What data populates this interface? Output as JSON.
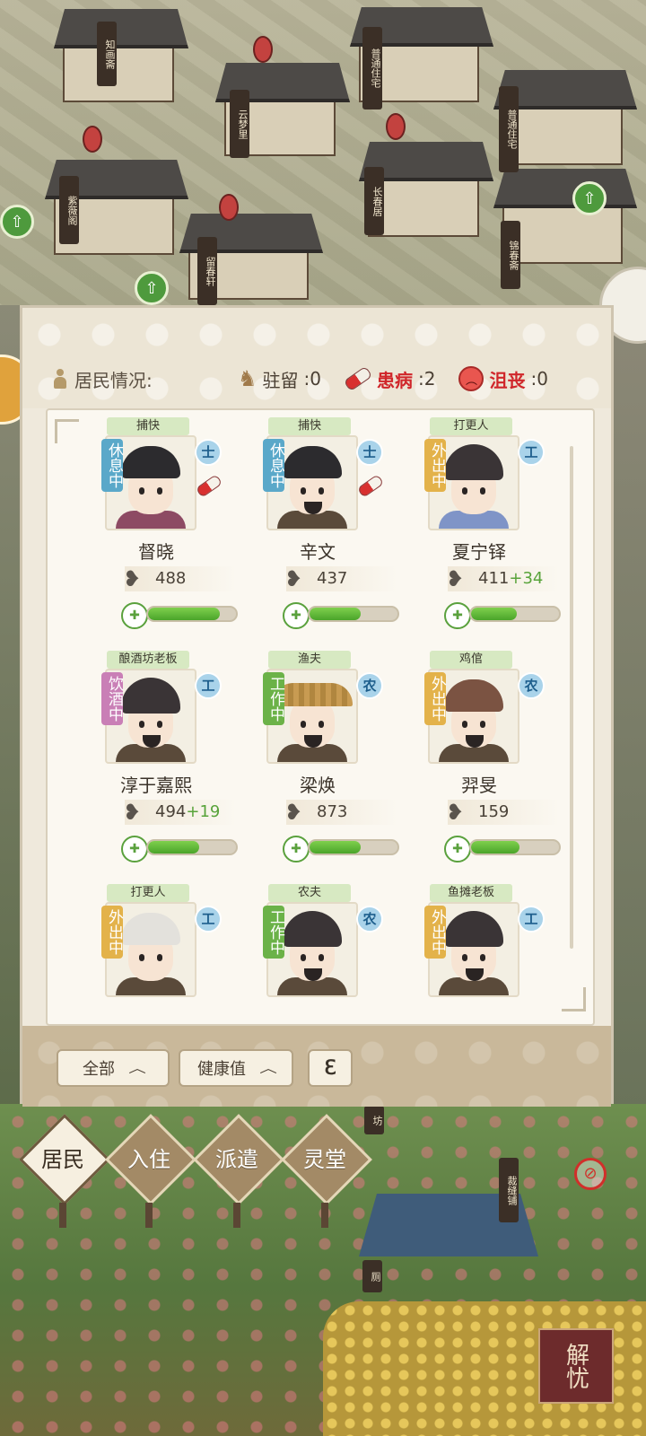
{
  "map": {
    "building_signs": [
      "知画斋",
      "普通住宅",
      "云梦里",
      "普通住宅",
      "紫薇阁",
      "长春居",
      "锦春斋",
      "留春轩"
    ],
    "bottom_sign_right": "裁缝铺",
    "bottom_sign_small": "坊",
    "bottom_sign_center": "厕",
    "jieyou_label": "解忧"
  },
  "summary": {
    "title": "居民情况:",
    "items": [
      {
        "icon": "horse-icon",
        "label": "驻留",
        "value": ":0",
        "color": "#4a3f33"
      },
      {
        "icon": "pill-icon",
        "label": "患病",
        "value": ":2",
        "color": "#d0262a"
      },
      {
        "icon": "sad-face-icon",
        "label": "沮丧",
        "value": ":0",
        "color": "#d0262a"
      }
    ]
  },
  "residents": [
    {
      "job": "捕快",
      "status": "休息中",
      "status_color": "blue",
      "class": "士",
      "sick": true,
      "name": "督晓",
      "stat": "488",
      "bonus": "",
      "health": 0.82,
      "look": "pink"
    },
    {
      "job": "捕快",
      "status": "休息中",
      "status_color": "blue",
      "class": "士",
      "sick": true,
      "name": "辛文",
      "stat": "437",
      "bonus": "",
      "health": 0.58,
      "look": "beard"
    },
    {
      "job": "打更人",
      "status": "外出中",
      "status_color": "yellow",
      "class": "工",
      "sick": false,
      "name": "夏宁铎",
      "stat": "411",
      "bonus": "+34",
      "health": 0.52,
      "look": "blue"
    },
    {
      "job": "酿酒坊老板",
      "status": "饮酒中",
      "status_color": "pink",
      "class": "工",
      "sick": false,
      "name": "淳于嘉熙",
      "stat": "494",
      "bonus": "+19",
      "health": 0.58,
      "look": "hair"
    },
    {
      "job": "渔夫",
      "status": "工作中",
      "status_color": "green",
      "class": "农",
      "sick": false,
      "name": "梁焕",
      "stat": "873",
      "bonus": "",
      "health": 0.58,
      "look": "straw"
    },
    {
      "job": "鸡倌",
      "status": "外出中",
      "status_color": "yellow",
      "class": "农",
      "sick": false,
      "name": "羿旻",
      "stat": "159",
      "bonus": "",
      "health": 0.55,
      "look": "cap"
    },
    {
      "job": "打更人",
      "status": "外出中",
      "status_color": "yellow",
      "class": "工",
      "sick": false,
      "name": "",
      "stat": "",
      "bonus": "",
      "health": 0,
      "look": "white"
    },
    {
      "job": "农夫",
      "status": "工作中",
      "status_color": "green",
      "class": "农",
      "sick": false,
      "name": "",
      "stat": "",
      "bonus": "",
      "health": 0,
      "look": "hair"
    },
    {
      "job": "鱼摊老板",
      "status": "外出中",
      "status_color": "yellow",
      "class": "工",
      "sick": false,
      "name": "",
      "stat": "",
      "bonus": "",
      "health": 0,
      "look": "hair"
    }
  ],
  "toolbar": {
    "filter_label": "全部",
    "sort_label": "健康值",
    "list_toggle_label": "ℇ"
  },
  "tabs": [
    {
      "label": "居民",
      "active": true
    },
    {
      "label": "入住",
      "active": false
    },
    {
      "label": "派遣",
      "active": false
    },
    {
      "label": "灵堂",
      "active": false
    }
  ]
}
